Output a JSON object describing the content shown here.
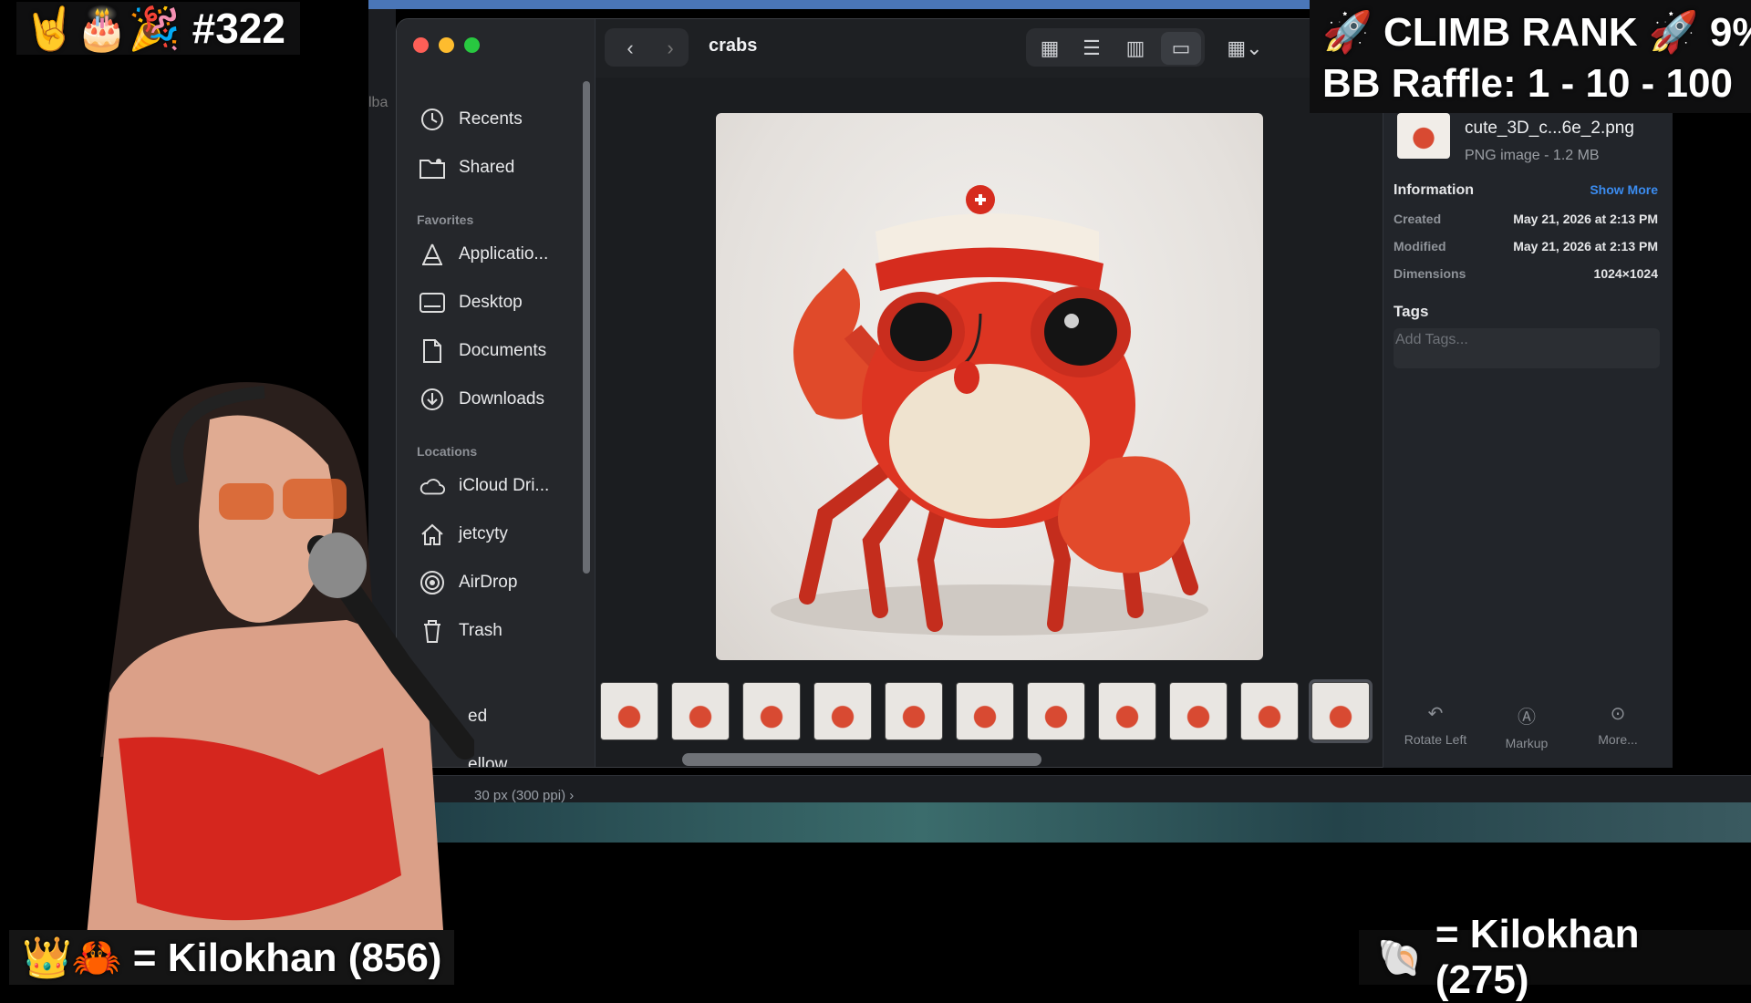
{
  "overlay": {
    "top_left": "🤘🎂🎉 #322",
    "top_right_line1": "🚀 CLIMB RANK 🚀 9%",
    "top_right_line2": "BB Raffle: 1 - 10 - 100",
    "bottom_left": "👑🦀 = Kilokhan (856)",
    "bottom_right_label": "= Kilokhan (275)"
  },
  "finder": {
    "folder_title": "crabs",
    "sidebar": {
      "recents": "Recents",
      "shared": "Shared",
      "favorites_header": "Favorites",
      "applications": "Applicatio...",
      "desktop": "Desktop",
      "documents": "Documents",
      "downloads": "Downloads",
      "locations_header": "Locations",
      "icloud": "iCloud Dri...",
      "home": "jetcyty",
      "airdrop": "AirDrop",
      "trash": "Trash",
      "partial_1": "ed",
      "partial_2": "ellow"
    },
    "info": {
      "file_name": "cute_3D_c...6e_2.png",
      "file_kind": "PNG image - 1.2 MB",
      "info_header": "Information",
      "show_more": "Show More",
      "created_label": "Created",
      "created_value": "May 21, 2026 at 2:13 PM",
      "modified_label": "Modified",
      "modified_value": "May 21, 2026 at 2:13 PM",
      "dimensions_label": "Dimensions",
      "dimensions_value": "1024×1024",
      "tags_header": "Tags",
      "tags_placeholder": "Add Tags...",
      "rotate_left": "Rotate Left",
      "markup": "Markup",
      "more": "More..."
    }
  },
  "background_window": {
    "status_text": "30 px (300 ppi)",
    "side_text": "lba"
  },
  "colors": {
    "close": "#fe5f57",
    "minimize": "#febc2e",
    "zoom": "#28c840",
    "link_blue": "#3b8cf0",
    "crab_red": "#d73a28"
  }
}
